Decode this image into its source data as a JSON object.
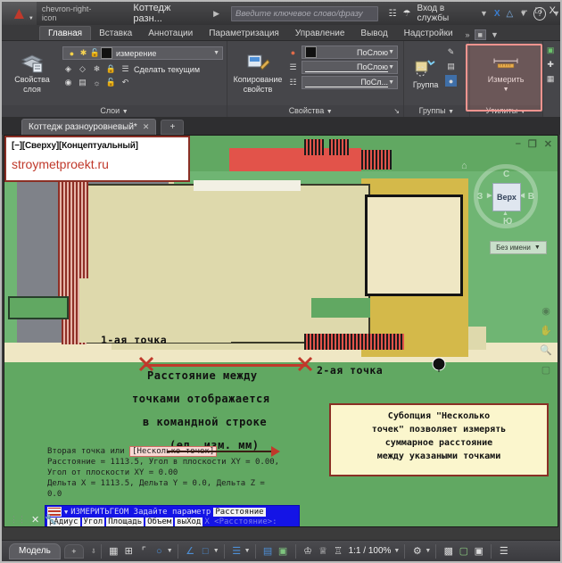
{
  "titlebar": {
    "doc_title": "Коттедж разн...",
    "search_placeholder": "Введите ключевое слово/фразу",
    "sign_in": "Вход в службы",
    "icons": {
      "app": "autocad-logo-icon",
      "qat_more": "chevron-right-icon",
      "binoculars": "search-binoculars-icon",
      "person": "user-icon",
      "x_app": "exchange-app-icon",
      "a360": "a360-icon",
      "help": "help-icon"
    },
    "window": {
      "minimize": "–",
      "maximize": "□",
      "close": "X"
    }
  },
  "ribbon": {
    "tabs": [
      {
        "label": "Главная",
        "active": true
      },
      {
        "label": "Вставка",
        "active": false
      },
      {
        "label": "Аннотации",
        "active": false
      },
      {
        "label": "Параметризация",
        "active": false
      },
      {
        "label": "Управление",
        "active": false
      },
      {
        "label": "Вывод",
        "active": false
      },
      {
        "label": "Надстройки",
        "active": false
      }
    ],
    "tabs_overflow": "»",
    "panels": [
      {
        "title": "Слои",
        "big_button": "Свойства\nслоя",
        "big_button_l1": "Свойства",
        "big_button_l2": "слоя",
        "layer_combo": "измерение",
        "make_current": "Сделать текущим"
      },
      {
        "title": "Свойства",
        "big_button_l1": "Копирование",
        "big_button_l2": "свойств",
        "color_combo": "ПоСлою",
        "lineweight_combo": "ПоСлою",
        "linetype_combo": "ПоСл..."
      },
      {
        "title": "Группы",
        "big_button_l1": "Группа",
        "big_button_l2": ""
      },
      {
        "title": "Утилиты",
        "big_button_l1": "Измерить",
        "big_button_l2": "",
        "highlighted": true
      }
    ]
  },
  "filetabs": {
    "tab_label": "Коттедж разноуровневый*",
    "close_glyph": "✕",
    "new_tab": "+"
  },
  "viewport": {
    "header_line1": "[−][Сверху][Концептуальный]",
    "header_line2": "stroymetproekt.ru",
    "viewcube": {
      "face": "Верх",
      "letters": {
        "top": "С",
        "left": "З",
        "right": "В",
        "bottom": "Ю"
      },
      "named_view": "Без имени"
    },
    "annotations": {
      "point1": "1-ая точка",
      "point2": "2-ая точка",
      "note_line1": "Расстояние между",
      "note_line2": "точками отображается",
      "note_line3": "в командной строке",
      "note_line4": "(ед. изм. мм)"
    },
    "callout": {
      "line1": "Субопция \"Несколько",
      "line2": "точек\" позволяет измерять",
      "line3": "суммарное расстояние",
      "line4": "между указаными точками"
    }
  },
  "command_history": {
    "line1_prefix": "Вторая точка или",
    "line1_option": "[Несколько точек]",
    "line2": "Расстояние = 1113.5,   Угол в плоскости XY = 0.00,",
    "line3": "Угол от плоскости XY = 0.00",
    "line4": "Дельта X = 1113.5,   Дельта Y = 0.0,    Дельта Z =",
    "line5": "0.0"
  },
  "dynamic_prompt": {
    "command": "ИЗМЕРИТЬГЕОМ Задайте параметр",
    "selected_option": "Расстояние",
    "options": [
      "рАдиус",
      "Угол",
      "Площадь",
      "Объем",
      "выХод"
    ],
    "trailing": "X  <Расстояние>:"
  },
  "statusbar": {
    "model_tab": "Модель",
    "add_tab": "+",
    "scale": "1:1 / 100%",
    "icons": [
      "grid-display-icon",
      "snap-mode-icon",
      "ortho-mode-icon",
      "polar-tracking-icon",
      "isometric-drafting-icon",
      "object-snap-icon",
      "annotation-visibility-icon",
      "selection-cycling-icon",
      "transparency-icon",
      "annotation-monitor-icon",
      "workspace-gear-icon",
      "hardware-accel-icon",
      "isolate-objects-icon",
      "customization-icon"
    ]
  },
  "colors": {
    "accent_red": "#c0392b",
    "highlight_pink": "#f2948f",
    "viewport_green": "#6fb573",
    "prompt_blue": "#1414e6",
    "callout_bg": "#fbf6cd",
    "plan_pale": "#ded9ac",
    "plan_khaki": "#d4b94a",
    "road_gray": "#7f8289"
  }
}
